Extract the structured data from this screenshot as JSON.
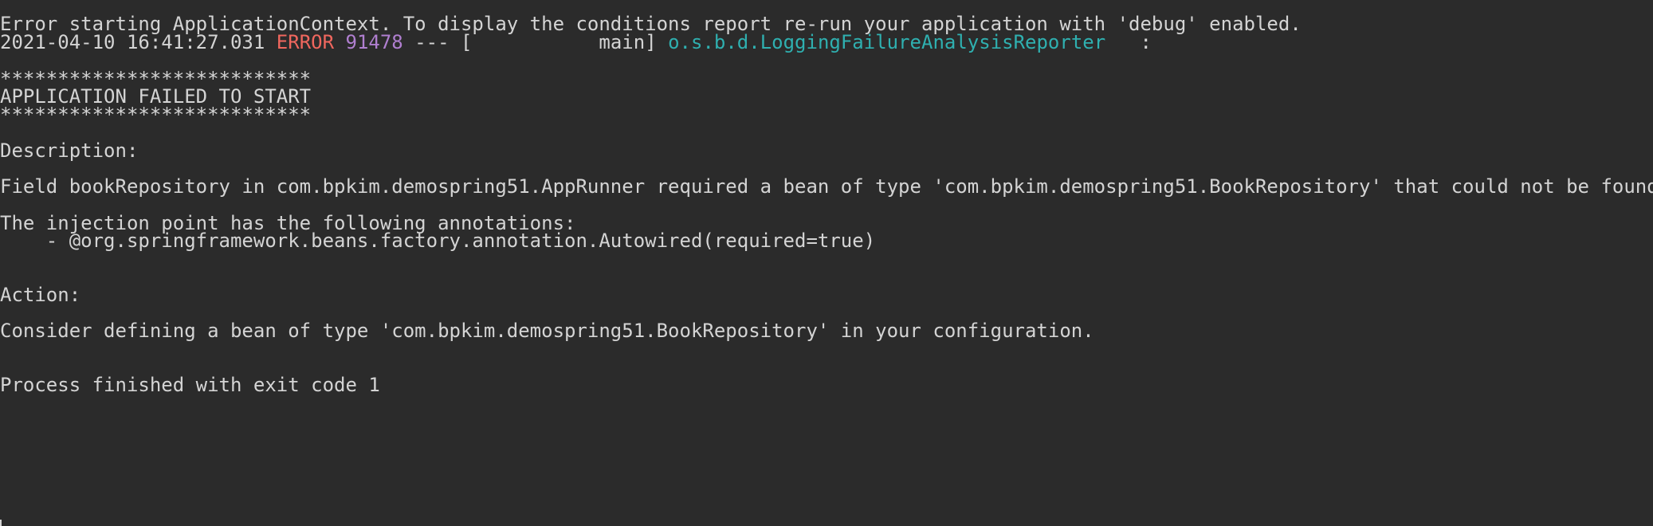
{
  "console": {
    "line1": "Error starting ApplicationContext. To display the conditions report re-run your application with 'debug' enabled.",
    "log": {
      "timestamp": "2021-04-10 16:41:27.031",
      "level": "ERROR",
      "pid": "91478",
      "separator": "---",
      "thread": "[           main]",
      "logger": "o.s.b.d.LoggingFailureAnalysisReporter",
      "colon": ":"
    },
    "stars_top": "***************************",
    "failed_title": "APPLICATION FAILED TO START",
    "stars_bottom": "***************************",
    "description_label": "Description:",
    "description_text": "Field bookRepository in com.bpkim.demospring51.AppRunner required a bean of type 'com.bpkim.demospring51.BookRepository' that could not be found.",
    "injection_label": "The injection point has the following annotations:",
    "injection_item": "    - @org.springframework.beans.factory.annotation.Autowired(required=true)",
    "action_label": "Action:",
    "action_text": "Consider defining a bean of type 'com.bpkim.demospring51.BookRepository' in your configuration.",
    "process_finished": "Process finished with exit code 1"
  },
  "colors": {
    "background": "#2b2b2b",
    "text": "#d4d4d4",
    "error_level": "#f0675e",
    "pid": "#b07fd0",
    "logger": "#2fb0b0"
  }
}
